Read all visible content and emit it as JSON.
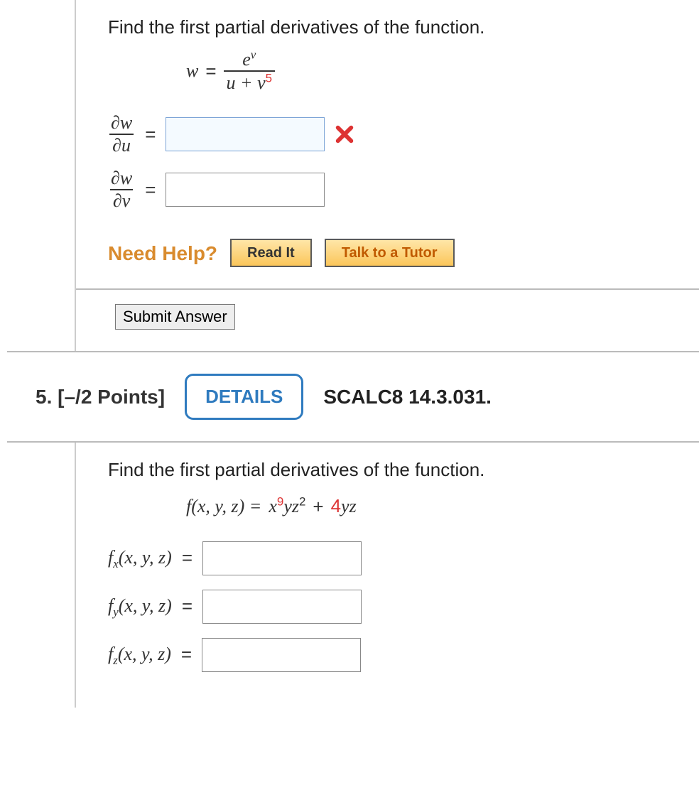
{
  "q4": {
    "prompt": "Find the first partial derivatives of the function.",
    "eq": {
      "lhs_var": "w",
      "eq_sym": " = ",
      "num_base": "e",
      "num_exp": "v",
      "den_left": "u + v",
      "den_exp": "5"
    },
    "rows": [
      {
        "d_sym": "∂",
        "top": "w",
        "bot": "u",
        "eq": " = ",
        "value": "",
        "filled": false,
        "wrong": true
      },
      {
        "d_sym": "∂",
        "top": "w",
        "bot": "v",
        "eq": " = ",
        "value": "",
        "filled": false,
        "wrong": false
      }
    ],
    "help_label": "Need Help?",
    "help_buttons": {
      "read": "Read It",
      "tutor": "Talk to a Tutor"
    },
    "submit": "Submit Answer"
  },
  "q5": {
    "number": "5.",
    "points": "[–/2 Points]",
    "details": "DETAILS",
    "source": "SCALC8 14.3.031.",
    "prompt": "Find the first partial derivatives of the function.",
    "eq": {
      "lhs": "f(x, y, z) = ",
      "t1_base": "x",
      "t1_exp": "9",
      "t1_mid": "yz",
      "t1_exp2": "2",
      "plus": " + ",
      "t2_coef": "4",
      "t2_rest": "yz"
    },
    "rows": [
      {
        "label_base": "f",
        "label_sub": "x",
        "label_rest": "(x, y, z)",
        "eq": " = ",
        "value": ""
      },
      {
        "label_base": "f",
        "label_sub": "y",
        "label_rest": "(x, y, z)",
        "eq": " = ",
        "value": ""
      },
      {
        "label_base": "f",
        "label_sub": "z",
        "label_rest": "(x, y, z)",
        "eq": " = ",
        "value": ""
      }
    ]
  }
}
